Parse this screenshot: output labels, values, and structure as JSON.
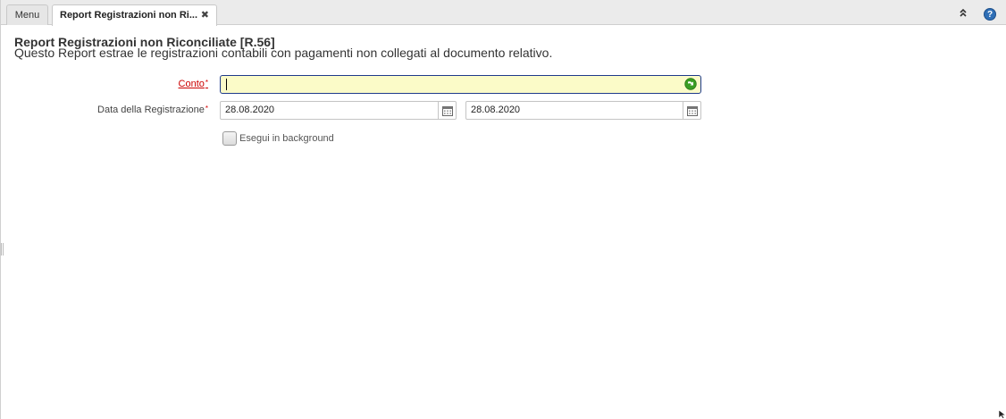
{
  "tabs": {
    "menu_label": "Menu",
    "report_label": "Report Registrazioni non Ri...",
    "close_glyph": "✖"
  },
  "toolbar": {
    "collapse_glyph": "»",
    "help_glyph": "?"
  },
  "header": {
    "title": "Report Registrazioni non Riconciliate [R.56]",
    "description": "Questo Report estrae le registrazioni contabili con pagamenti non collegati al documento relativo."
  },
  "form": {
    "conto": {
      "label": "Conto",
      "required_mark": "*",
      "value": ""
    },
    "data_registrazione": {
      "label": "Data della Registrazione",
      "required_mark": "*",
      "from": "28.08.2020",
      "to": "28.08.2020"
    },
    "background": {
      "label": "Esegui in background",
      "checked": false
    }
  },
  "icons": {
    "search": "green-arrow-lookup-icon",
    "calendar": "calendar-icon",
    "help": "help-icon",
    "collapse": "double-chevron-up-icon"
  },
  "colors": {
    "required_label": "#cc0000",
    "mandatory_field_bg": "#fbfbc8",
    "focus_border": "#1e3a8a",
    "help_blue": "#2f6fb6",
    "lookup_green": "#3a9d23"
  }
}
